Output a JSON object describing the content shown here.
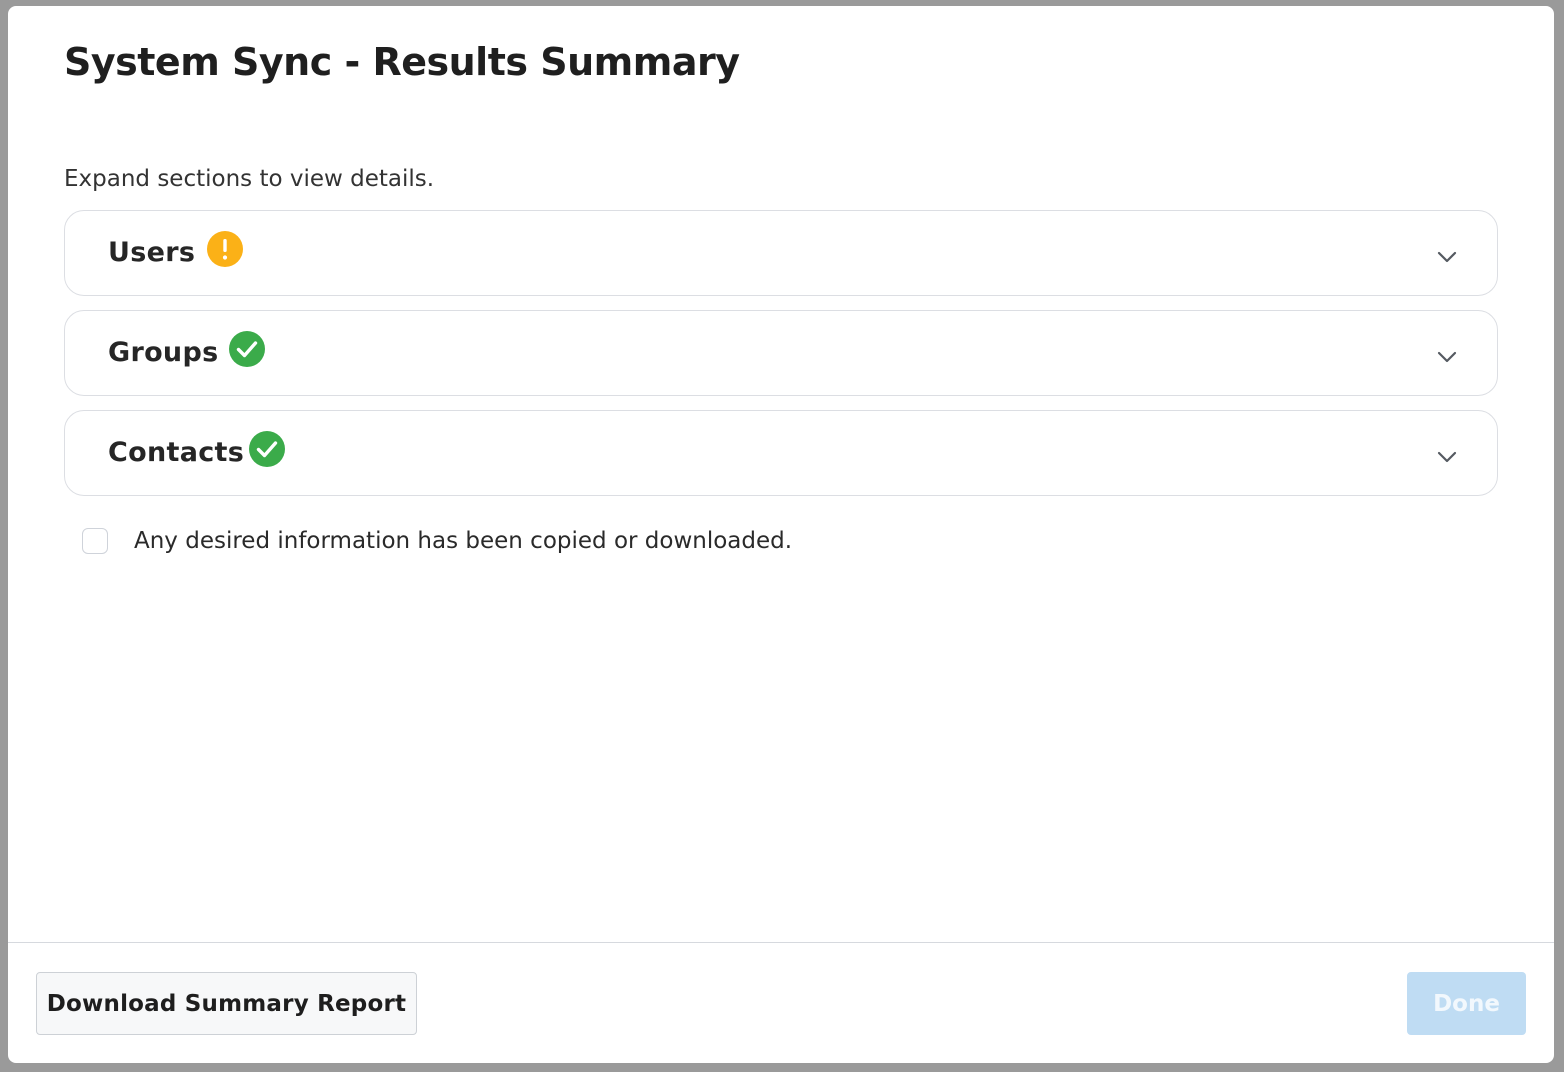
{
  "modal": {
    "title": "System Sync - Results Summary",
    "instructions": "Expand sections to view details."
  },
  "sections": [
    {
      "label": "Users",
      "status": "warning",
      "icon": "warning-icon",
      "status_color": "#fbb117"
    },
    {
      "label": "Groups",
      "status": "success",
      "icon": "check-circle-icon",
      "status_color": "#3bab4a"
    },
    {
      "label": "Contacts",
      "status": "success",
      "icon": "check-circle-icon",
      "status_color": "#3bab4a"
    }
  ],
  "acknowledgement": {
    "label": "Any desired information has been copied or downloaded.",
    "checked": false
  },
  "footer": {
    "download_label": "Download Summary Report",
    "done_label": "Done",
    "done_disabled": true
  },
  "colors": {
    "primary_disabled": "#bfdcf3",
    "warning": "#fbb117",
    "success": "#3bab4a"
  }
}
